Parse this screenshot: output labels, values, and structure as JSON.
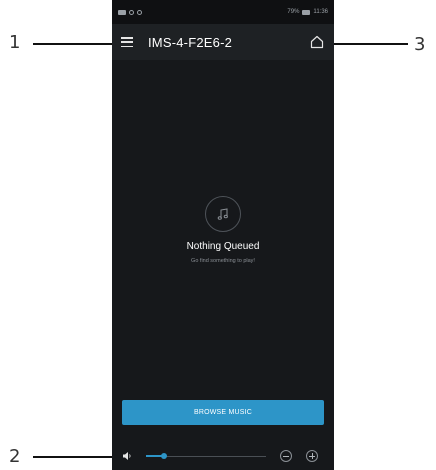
{
  "callouts": {
    "one": "1",
    "two": "2",
    "three": "3"
  },
  "status_bar": {
    "battery": "79%",
    "time": "11:36"
  },
  "header": {
    "device_name": "IMS-4-F2E6-2",
    "menu_icon": "hamburger-menu-icon",
    "home_icon": "home-icon"
  },
  "empty_state": {
    "icon": "music-note-icon",
    "title": "Nothing Queued",
    "subtitle": "Go find something to play!"
  },
  "browse_button": {
    "label": "BROWSE MUSIC"
  },
  "volume": {
    "level": 0.15,
    "speaker_icon": "speaker-icon",
    "minus_icon": "volume-down-icon",
    "plus_icon": "volume-up-icon"
  },
  "colors": {
    "accent": "#2d95c8",
    "background": "#16181b",
    "header": "#1e2124"
  }
}
